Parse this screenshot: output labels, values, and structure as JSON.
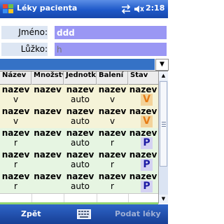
{
  "titlebar": {
    "title": "Léky pacienta",
    "time": "2:18"
  },
  "form": {
    "name_label": "Jméno:",
    "name_value": "ddd",
    "bed_label": "Lůžko:",
    "bed_value": "",
    "bed_placeholder": "h"
  },
  "grid": {
    "columns": [
      "Název",
      "Množstv",
      "Jednotk",
      "Balení",
      "Stav"
    ],
    "rows": [
      {
        "c1": [
          "nazev",
          "v"
        ],
        "c2": [
          "nazev",
          ""
        ],
        "c3": [
          "nazev",
          "auto"
        ],
        "c4": [
          "nazev",
          "v"
        ],
        "c5": [
          "nazev",
          ""
        ],
        "stav": "V"
      },
      {
        "c1": [
          "nazev",
          "v"
        ],
        "c2": [
          "nazev",
          ""
        ],
        "c3": [
          "nazev",
          "auto"
        ],
        "c4": [
          "nazev",
          "v"
        ],
        "c5": [
          "nazev",
          ""
        ],
        "stav": "V"
      },
      {
        "c1": [
          "nazev",
          "r"
        ],
        "c2": [
          "nazev",
          ""
        ],
        "c3": [
          "nazev",
          "auto"
        ],
        "c4": [
          "nazev",
          "r"
        ],
        "c5": [
          "nazev",
          ""
        ],
        "stav": "P"
      },
      {
        "c1": [
          "nazev",
          "r"
        ],
        "c2": [
          "nazev",
          ""
        ],
        "c3": [
          "nazev",
          "auto"
        ],
        "c4": [
          "nazev",
          "r"
        ],
        "c5": [
          "nazev",
          ""
        ],
        "stav": "P"
      },
      {
        "c1": [
          "nazev",
          "r"
        ],
        "c2": [
          "nazev",
          ""
        ],
        "c3": [
          "nazev",
          "auto"
        ],
        "c4": [
          "nazev",
          "r"
        ],
        "c5": [
          "nazev",
          ""
        ],
        "stav": "P"
      }
    ]
  },
  "menubar": {
    "left": "Zpět",
    "right": "Podat léky"
  },
  "colors": {
    "title_bar": "#1e58c8",
    "input_bg": "#9a97f4",
    "row_highlight": "#f5f3d8",
    "row_green": "#e6f5e2"
  }
}
